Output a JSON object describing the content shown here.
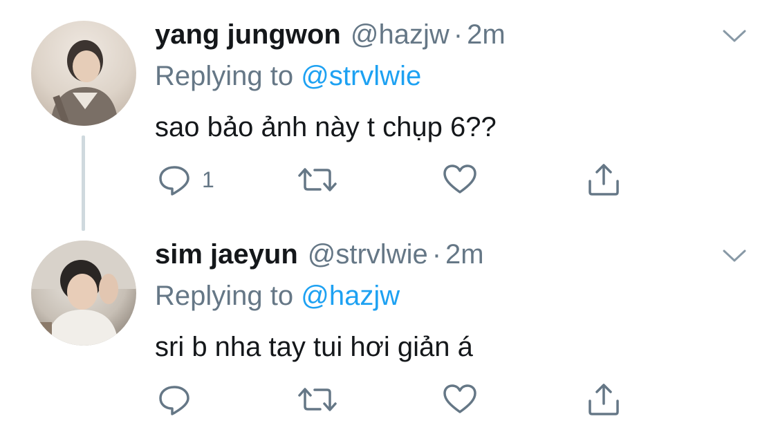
{
  "tweets": [
    {
      "name": "yang jungwon",
      "handle": "@hazjw",
      "separator": "·",
      "time": "2m",
      "replying_prefix": "Replying to",
      "replying_to": "@strvlwie",
      "text": "sao bảo ảnh này t chụp 6??",
      "reply_count": "1",
      "avatar_icon": "profile-photo"
    },
    {
      "name": "sim jaeyun",
      "handle": "@strvlwie",
      "separator": "·",
      "time": "2m",
      "replying_prefix": "Replying to",
      "replying_to": "@hazjw",
      "text": "sri b nha tay tui hơi giản á",
      "reply_count": "",
      "avatar_icon": "profile-photo"
    }
  ],
  "colors": {
    "text": "#14171a",
    "secondary": "#657786",
    "link": "#1da1f2",
    "thread_line": "#cfd9de"
  },
  "icons": [
    "reply-icon",
    "retweet-icon",
    "like-icon",
    "share-icon",
    "chevron-down-icon"
  ]
}
